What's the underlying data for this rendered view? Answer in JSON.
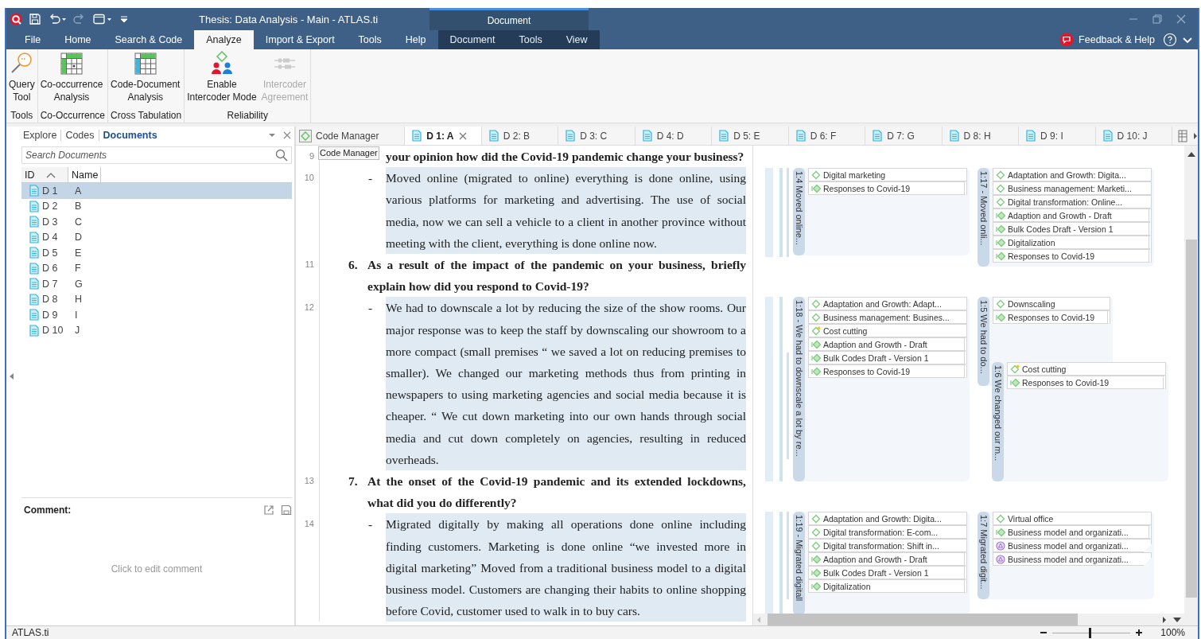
{
  "window": {
    "title": "Thesis: Data Analysis - Main - ATLAS.ti",
    "context_group": "Document"
  },
  "menu_tabs": [
    {
      "label": "File",
      "selected": false,
      "contextual": false
    },
    {
      "label": "Home",
      "selected": false,
      "contextual": false
    },
    {
      "label": "Search & Code",
      "selected": false,
      "contextual": false
    },
    {
      "label": "Analyze",
      "selected": true,
      "contextual": false
    },
    {
      "label": "Import & Export",
      "selected": false,
      "contextual": false
    },
    {
      "label": "Tools",
      "selected": false,
      "contextual": false
    },
    {
      "label": "Help",
      "selected": false,
      "contextual": false
    },
    {
      "label": "Document",
      "selected": false,
      "contextual": true
    },
    {
      "label": "Tools",
      "selected": false,
      "contextual": true
    },
    {
      "label": "View",
      "selected": false,
      "contextual": true
    }
  ],
  "feedback": "Feedback & Help",
  "ribbon": [
    {
      "label": "Tools",
      "buttons": [
        {
          "lines": [
            "Query",
            "Tool"
          ],
          "disabled": false
        }
      ]
    },
    {
      "label": "Co-Occurrence",
      "buttons": [
        {
          "lines": [
            "Co-occurrence",
            "Analysis"
          ],
          "disabled": false
        }
      ]
    },
    {
      "label": "Cross Tabulation",
      "buttons": [
        {
          "lines": [
            "Code-Document",
            "Analysis"
          ],
          "disabled": false
        }
      ]
    },
    {
      "label": "Reliability",
      "buttons": [
        {
          "lines": [
            "Enable",
            "Intercoder Mode"
          ],
          "disabled": false
        },
        {
          "lines": [
            "Intercoder",
            "Agreement"
          ],
          "disabled": true
        }
      ]
    }
  ],
  "navigator": {
    "tabs": [
      {
        "label": "Explore",
        "selected": false
      },
      {
        "label": "Codes",
        "selected": false
      },
      {
        "label": "Documents",
        "selected": true
      }
    ],
    "search": {
      "placeholder": "Search Documents"
    },
    "columns": [
      {
        "label": "ID",
        "sorted": true
      },
      {
        "label": "Name",
        "sorted": false
      }
    ],
    "rows": [
      {
        "id": "D 1",
        "name": "A",
        "selected": true
      },
      {
        "id": "D 2",
        "name": "B",
        "selected": false
      },
      {
        "id": "D 3",
        "name": "C",
        "selected": false
      },
      {
        "id": "D 4",
        "name": "D",
        "selected": false
      },
      {
        "id": "D 5",
        "name": "E",
        "selected": false
      },
      {
        "id": "D 6",
        "name": "F",
        "selected": false
      },
      {
        "id": "D 7",
        "name": "G",
        "selected": false
      },
      {
        "id": "D 8",
        "name": "H",
        "selected": false
      },
      {
        "id": "D 9",
        "name": "I",
        "selected": false
      },
      {
        "id": "D 10",
        "name": "J",
        "selected": false
      }
    ]
  },
  "comment": {
    "title": "Comment:",
    "placeholder": "Click to edit comment"
  },
  "doc_tabs": [
    {
      "label": "Code Manager",
      "kind": "manager",
      "selected": false
    },
    {
      "label": "D 1: A",
      "kind": "document",
      "selected": true
    },
    {
      "label": "D 2: B",
      "kind": "document",
      "selected": false
    },
    {
      "label": "D 3: C",
      "kind": "document",
      "selected": false
    },
    {
      "label": "D 4: D",
      "kind": "document",
      "selected": false
    },
    {
      "label": "D 5: E",
      "kind": "document",
      "selected": false
    },
    {
      "label": "D 6: F",
      "kind": "document",
      "selected": false
    },
    {
      "label": "D 7: G",
      "kind": "document",
      "selected": false
    },
    {
      "label": "D 8: H",
      "kind": "document",
      "selected": false
    },
    {
      "label": "D 9: I",
      "kind": "document",
      "selected": false
    },
    {
      "label": "D 10: J",
      "kind": "document",
      "selected": false
    }
  ],
  "tooltip": "Code Manager",
  "document": [
    {
      "number": "9",
      "kind": "question",
      "text": "your opinion how did the Covid-19 pandemic change your business?"
    },
    {
      "number": "10",
      "kind": "answer",
      "marker": "-",
      "text": "Moved online (migrated to online) everything is done online, using various platforms for marketing and advertising. The use of social media, now we can sell a vehicle to a client in another province without meeting with the client, everything is done online now."
    },
    {
      "number": "11",
      "kind": "question",
      "marker": "6.",
      "text": "As a result of the impact of the pandemic on your business, briefly explain how did you respond to Covid-19?"
    },
    {
      "number": "12",
      "kind": "answer",
      "marker": "-",
      "text": "We had to downscale a lot by reducing the size of the show rooms. Our major response was to keep the staff by downscaling our showroom to a more compact (small premises “ we saved a lot on reducing premises to smaller). We changed our marketing methods thus from printing in newspapers to using marketing agencies and social media because it is cheaper. “ We cut down marketing into our own hands through social media and cut down completely on agencies, resulting in reduced overheads."
    },
    {
      "number": "13",
      "kind": "question",
      "marker": "7.",
      "text": "At the onset of the Covid-19 pandemic and its extended lockdowns, what did you do differently?"
    },
    {
      "number": "14",
      "kind": "answer",
      "marker": "-",
      "text": "Migrated digitally by making all operations done online including finding customers. Marketing is done online “we invested more in digital marketing” Moved from a traditional business model to a digital business model. Customers are changing their habits to online shopping before Covid, customer used to walk in to buy cars."
    }
  ],
  "margin": [
    {
      "label": "1:4 Moved online...",
      "codes": [
        {
          "name": "Digital marketing",
          "kind": "code"
        },
        {
          "name": "Responses to Covid-19",
          "kind": "linked"
        }
      ]
    },
    {
      "label": "1:17 - Moved onli...",
      "codes": [
        {
          "name": "Adaptation and Growth: Digita...",
          "kind": "code"
        },
        {
          "name": "Business management: Marketi...",
          "kind": "code"
        },
        {
          "name": "Digital transformation: Online...",
          "kind": "code"
        },
        {
          "name": "Adaption and Growth - Draft",
          "kind": "linked"
        },
        {
          "name": "Bulk Codes Draft - Version 1",
          "kind": "linked"
        },
        {
          "name": "Digitalization",
          "kind": "linked"
        },
        {
          "name": "Responses to Covid-19",
          "kind": "linked"
        }
      ]
    },
    {
      "label": "1:18 - We had to downscale a lot by re...",
      "codes": [
        {
          "name": "Adaptation and Growth: Adapt...",
          "kind": "code"
        },
        {
          "name": "Business management: Busines...",
          "kind": "code"
        },
        {
          "name": "Cost cutting",
          "kind": "commented"
        },
        {
          "name": "Adaption and Growth - Draft",
          "kind": "linked"
        },
        {
          "name": "Bulk Codes Draft - Version 1",
          "kind": "linked"
        },
        {
          "name": "Responses to Covid-19",
          "kind": "linked"
        }
      ]
    },
    {
      "label": "1:5 We had to do...",
      "codes": [
        {
          "name": "Downscaling",
          "kind": "code"
        },
        {
          "name": "Responses to Covid-19",
          "kind": "linked"
        }
      ]
    },
    {
      "label": "1:6 We changed our m...",
      "codes": [
        {
          "name": "Cost cutting",
          "kind": "commented"
        },
        {
          "name": "Responses to Covid-19",
          "kind": "linked"
        }
      ]
    },
    {
      "label": "1:19 - Migrated digitall",
      "codes": [
        {
          "name": "Adaptation and Growth: Digita...",
          "kind": "code"
        },
        {
          "name": "Digital transformation: E-com...",
          "kind": "code"
        },
        {
          "name": "Digital transformation: Shift in...",
          "kind": "code"
        },
        {
          "name": "Adaption and Growth - Draft",
          "kind": "linked"
        },
        {
          "name": "Bulk Codes Draft - Version 1",
          "kind": "linked"
        },
        {
          "name": "Digitalization",
          "kind": "linked"
        }
      ]
    },
    {
      "label": "1:7 Migrated digit...",
      "codes": [
        {
          "name": "Virtual office",
          "kind": "code"
        },
        {
          "name": "Business model and organizati...",
          "kind": "linked"
        },
        {
          "name": "Business model and organizati...",
          "kind": "network"
        },
        {
          "name": "Business model and organizati...",
          "kind": "network"
        }
      ]
    }
  ],
  "status_bar": {
    "text": "ATLAS.ti",
    "zoom": {
      "level": 0.48,
      "reading": "100%"
    }
  }
}
